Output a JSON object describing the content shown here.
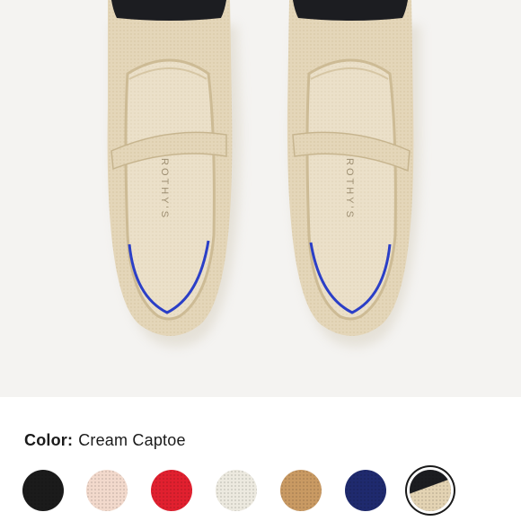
{
  "product": {
    "brand_mark": "ROTHY'S",
    "image_name": "Mary Jane flats"
  },
  "color_selector": {
    "label": "Color:",
    "selected_value": "Cream Captoe",
    "swatches": [
      {
        "id": "black",
        "color": "#1b1b1b",
        "selected": false
      },
      {
        "id": "blush",
        "color": "#f2d9cc",
        "selected": false
      },
      {
        "id": "red",
        "color": "#e1202f",
        "selected": false
      },
      {
        "id": "ivory",
        "color": "#ece9df",
        "selected": false
      },
      {
        "id": "camel",
        "color": "#c99a63",
        "selected": false
      },
      {
        "id": "navy",
        "color": "#1f2a6e",
        "selected": false
      },
      {
        "id": "cream-captoe",
        "color": "#e3d3b3",
        "toe_color": "#1c1d21",
        "selected": true
      }
    ]
  },
  "colors": {
    "knit": "#e4d6b9",
    "knit_shadow": "#cbb994",
    "insole": "#e9dec6",
    "cap_toe": "#1c1d21",
    "heel_tab": "#2b3fc7",
    "background": "#f4f3f1"
  }
}
